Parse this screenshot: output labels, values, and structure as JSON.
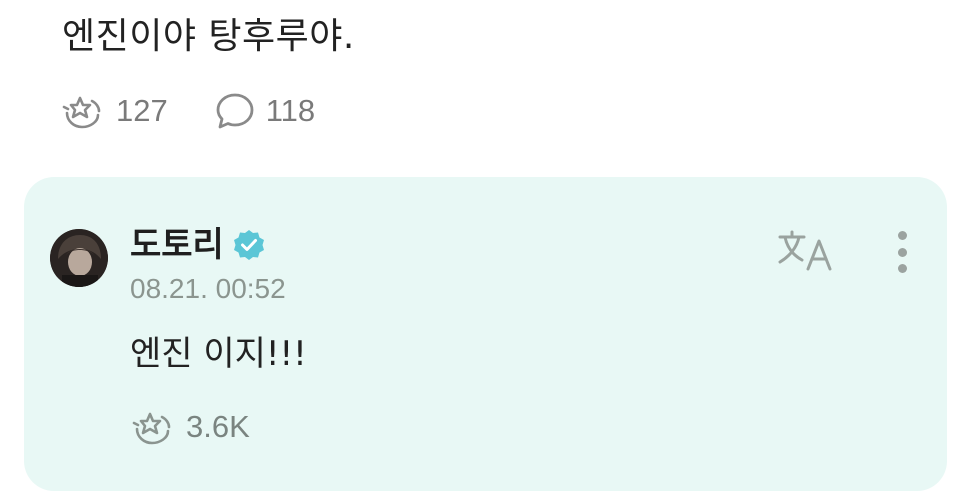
{
  "post": {
    "text": "엔진이야 탕후루야.",
    "reactions": {
      "icon": "star-reaction-icon",
      "count": "127"
    },
    "comments": {
      "icon": "speech-bubble-icon",
      "count": "118"
    }
  },
  "reply": {
    "author": "도토리",
    "verified": true,
    "verified_color": "#5bc6d6",
    "timestamp": "08.21. 00:52",
    "text": "엔진 이지!!!",
    "reactions": {
      "icon": "star-reaction-icon",
      "count": "3.6K"
    },
    "translate_icon": "translate-icon",
    "menu_icon": "more-vertical-icon",
    "background_color": "#e8f8f5"
  }
}
